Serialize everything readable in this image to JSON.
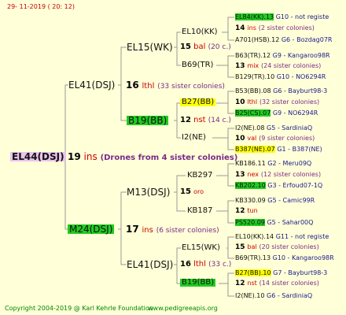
{
  "header": {
    "date": "29-  11-2019  ( 20:  12)"
  },
  "footer": {
    "copyright": "Copyright 2004-2019 @ Karl Kehrle Foundation",
    "site": "www.pedigreeapis.org"
  },
  "root": {
    "name": "EL44(DSJ)",
    "gen": "19",
    "suffix": "ins",
    "note": "(Drones from 4 sister colonies)"
  },
  "level1": {
    "top": {
      "name": "EL41(DSJ)",
      "gen": "16",
      "suffix": "lthl",
      "note": "(33 sister colonies)"
    },
    "bottom": {
      "name": "M24(DSJ)",
      "gen": "17",
      "suffix": "ins",
      "note": "(6 sister colonies)"
    }
  },
  "level2": {
    "el15_a": {
      "name": "EL15(WK)",
      "gen": "15",
      "suffix": "bal",
      "note": "(20 c.)"
    },
    "b19_a": {
      "name": "B19(BB)",
      "gen": "12",
      "suffix": "nst",
      "note": "(14 c.)"
    },
    "m13": {
      "name": "M13(DSJ)",
      "gen": "15",
      "suffix": "oro"
    },
    "el41_b": {
      "name": "EL41(DSJ)",
      "gen": "16",
      "suffix": "lthl",
      "note": "(33 c.)"
    }
  },
  "level3": {
    "el10": "EL10(KK)",
    "b69": "B69(TR)",
    "b27_a": "B27(BB)",
    "i2ne_a": "I2(NE)",
    "kb297": "KB297",
    "kb187": "KB187",
    "el15_b": "EL15(WK)",
    "b19_b": "B19(BB)"
  },
  "level4": [
    {
      "name": "EL84(KK).13",
      "info": "G10 - not registe"
    },
    {
      "gen": "14",
      "suffix": "ins",
      "note": "(2 sister colonies)"
    },
    {
      "name": "A701(HSB).12",
      "info": "G6 - Bozdag07R"
    },
    {
      "name": "B63(TR).12",
      "info": "G9 - Kangaroo98R"
    },
    {
      "gen": "13",
      "suffix": "mix",
      "note": "(24 sister colonies)"
    },
    {
      "name": "B129(TR).10",
      "info": "G10 - NO6294R"
    },
    {
      "name": "B53(BB).08",
      "info": "G6 - Bayburt98-3"
    },
    {
      "gen": "10",
      "suffix": "lthl",
      "note": "(32 sister colonies)"
    },
    {
      "name": "B25(CS).07",
      "info": "G9 - NO6294R"
    },
    {
      "name": "I2(NE).08",
      "info": "G5 - SardiniaQ"
    },
    {
      "gen": "10",
      "suffix": "val",
      "note": "(9 sister colonies)"
    },
    {
      "name": "B387(NE).07",
      "info": "G1 - B387(NE)"
    },
    {
      "name": "KB186.11",
      "info": "G2 - Meru09Q"
    },
    {
      "gen": "13",
      "suffix": "nex",
      "note": "(12 sister colonies)"
    },
    {
      "name": "KB202.10",
      "info": "G3 - Erfoud07-1Q"
    },
    {
      "name": "KB330.09",
      "info": "G5 - Camic99R"
    },
    {
      "gen": "12",
      "suffix": "tun"
    },
    {
      "name": "PS520.09",
      "info": "G5 - Sahar00Q"
    },
    {
      "name": "EL10(KK).14",
      "info": "G11 - not registe"
    },
    {
      "gen": "15",
      "suffix": "bal",
      "note": "(20 sister colonies)"
    },
    {
      "name": "B69(TR).13",
      "info": "G10 - Kangaroo98R"
    },
    {
      "name": "B27(BB).10",
      "info": "G7 - Bayburt98-3"
    },
    {
      "gen": "12",
      "suffix": "nst",
      "note": "(14 sister colonies)"
    },
    {
      "name": "I2(NE).10",
      "info": "G6 - SardiniaQ"
    }
  ]
}
